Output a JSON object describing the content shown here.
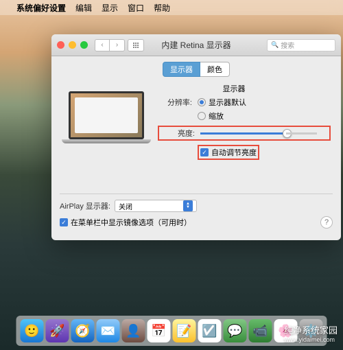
{
  "menubar": {
    "app": "系统偏好设置",
    "items": [
      "编辑",
      "显示",
      "窗口",
      "帮助"
    ]
  },
  "window": {
    "title": "内建 Retina 显示器",
    "search_placeholder": "搜索",
    "tabs": {
      "display": "显示器",
      "color": "颜色"
    },
    "section_label": "显示器",
    "resolution": {
      "label": "分辨率:",
      "default": "显示器默认",
      "scaled": "缩放"
    },
    "brightness": {
      "label": "亮度:",
      "value": 73
    },
    "auto_brightness": "自动调节亮度",
    "airplay": {
      "label": "AirPlay 显示器:",
      "value": "关闭"
    },
    "mirror": "在菜单栏中显示镜像选项（可用时）"
  },
  "dock_icons": [
    {
      "name": "finder",
      "bg": "linear-gradient(#4fc3f7,#1976d2)",
      "glyph": "🙂"
    },
    {
      "name": "launchpad",
      "bg": "linear-gradient(#9575cd,#5e35b1)",
      "glyph": "🚀"
    },
    {
      "name": "safari",
      "bg": "linear-gradient(#64b5f6,#1565c0)",
      "glyph": "🧭"
    },
    {
      "name": "mail",
      "bg": "linear-gradient(#90caf9,#1e88e5)",
      "glyph": "✉️"
    },
    {
      "name": "contacts",
      "bg": "linear-gradient(#bcaaa4,#6d4c41)",
      "glyph": "👤"
    },
    {
      "name": "calendar",
      "bg": "#fff",
      "glyph": "📅"
    },
    {
      "name": "notes",
      "bg": "linear-gradient(#fff59d,#fbc02d)",
      "glyph": "📝"
    },
    {
      "name": "reminders",
      "bg": "#fff",
      "glyph": "☑️"
    },
    {
      "name": "messages",
      "bg": "linear-gradient(#81c784,#388e3c)",
      "glyph": "💬"
    },
    {
      "name": "facetime",
      "bg": "linear-gradient(#66bb6a,#2e7d32)",
      "glyph": "📹"
    },
    {
      "name": "photos",
      "bg": "#fff",
      "glyph": "🌸"
    },
    {
      "name": "settings",
      "bg": "linear-gradient(#bdbdbd,#757575)",
      "glyph": "⚙️"
    }
  ],
  "watermark": {
    "title": "纯净系统家园",
    "url": "www.yidaimei.com"
  }
}
